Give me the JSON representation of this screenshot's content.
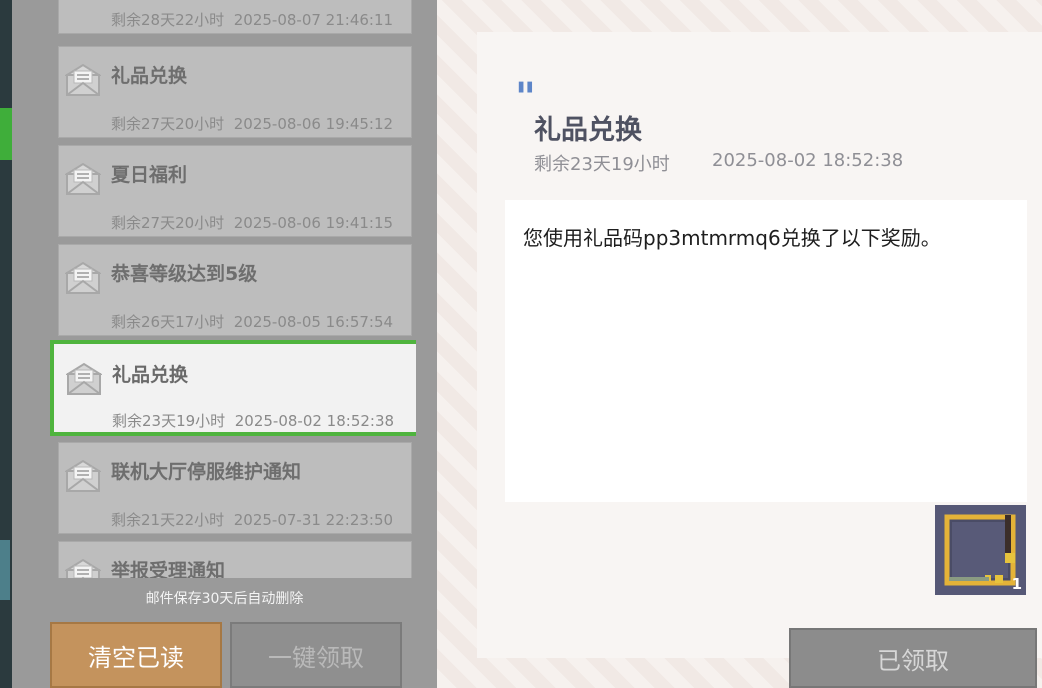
{
  "mail_list": {
    "items": [
      {
        "title": "",
        "remaining": "剩余28天22小时",
        "date": "2025-08-07 21:46:11",
        "selected": false
      },
      {
        "title": "礼品兑换",
        "remaining": "剩余27天20小时",
        "date": "2025-08-06 19:45:12",
        "selected": false
      },
      {
        "title": "夏日福利",
        "remaining": "剩余27天20小时",
        "date": "2025-08-06 19:41:15",
        "selected": false
      },
      {
        "title": "恭喜等级达到5级",
        "remaining": "剩余26天17小时",
        "date": "2025-08-05 16:57:54",
        "selected": false
      },
      {
        "title": "礼品兑换",
        "remaining": "剩余23天19小时",
        "date": "2025-08-02 18:52:38",
        "selected": true
      },
      {
        "title": "联机大厅停服维护通知",
        "remaining": "剩余21天22小时",
        "date": "2025-07-31 22:23:50",
        "selected": false
      },
      {
        "title": "举报受理通知",
        "remaining": "",
        "date": "",
        "selected": false
      }
    ],
    "retention_note": "邮件保存30天后自动删除",
    "clear_read_label": "清空已读",
    "claim_all_label": "一键领取"
  },
  "detail": {
    "title": "礼品兑换",
    "remaining": "剩余23天19小时",
    "date": "2025-08-02 18:52:38",
    "body": "您使用礼品码pp3mtmrmq6兑换了以下奖励。",
    "reward": {
      "icon": "gold-frame-icon",
      "count": "1"
    },
    "claimed_label": "已领取"
  },
  "colors": {
    "accent_green": "#4fb43e",
    "clear_button": "#c4935d",
    "quote_blue": "#5d85c8"
  }
}
